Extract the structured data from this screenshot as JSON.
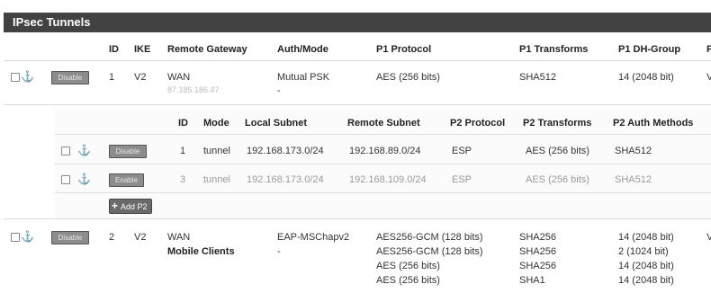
{
  "panel": {
    "title": "IPsec Tunnels"
  },
  "p1_headers": {
    "id": "ID",
    "ike": "IKE",
    "remote_gateway": "Remote Gateway",
    "auth_mode": "Auth/Mode",
    "p1_protocol": "P1 Protocol",
    "p1_transforms": "P1 Transforms",
    "p1_dh_group": "P1 DH-Group",
    "cut": "P"
  },
  "p1_rows": [
    {
      "button": "Disable",
      "id": "1",
      "ike": "V2",
      "gateway": "WAN",
      "gateway_sub": "87.185.186.47",
      "auth": "Mutual PSK",
      "auth_sub": "-",
      "protocol": [
        "AES (256 bits)"
      ],
      "transforms": [
        "SHA512"
      ],
      "dh_group": [
        "14 (2048 bit)"
      ],
      "cut": "V"
    },
    {
      "button": "Disable",
      "id": "2",
      "ike": "V2",
      "gateway": "WAN",
      "gateway_sub": "Mobile Clients",
      "auth": "EAP-MSChapv2",
      "auth_sub": "-",
      "protocol": [
        "AES256-GCM (128 bits)",
        "AES256-GCM (128 bits)",
        "AES (256 bits)",
        "AES (256 bits)"
      ],
      "transforms": [
        "SHA256",
        "SHA256",
        "SHA256",
        "SHA1"
      ],
      "dh_group": [
        "14 (2048 bit)",
        "2 (1024 bit)",
        "14 (2048 bit)",
        "14 (2048 bit)"
      ],
      "cut": "V"
    }
  ],
  "p2_headers": {
    "id": "ID",
    "mode": "Mode",
    "local_subnet": "Local Subnet",
    "remote_subnet": "Remote Subnet",
    "p2_protocol": "P2 Protocol",
    "p2_transforms": "P2 Transforms",
    "p2_auth": "P2 Auth Methods"
  },
  "p2_rows": [
    {
      "button": "Disable",
      "id": "1",
      "mode": "tunnel",
      "local": "192.168.173.0/24",
      "remote": "192.168.89.0/24",
      "protocol": "ESP",
      "transforms": "AES (256 bits)",
      "auth": "SHA512",
      "disabled": false
    },
    {
      "button": "Enable",
      "id": "3",
      "mode": "tunnel",
      "local": "192.168.173.0/24",
      "remote": "192.168.109.0/24",
      "protocol": "ESP",
      "transforms": "AES (256 bits)",
      "auth": "SHA512",
      "disabled": true
    }
  ],
  "add_p2": {
    "label": "Add P2"
  }
}
